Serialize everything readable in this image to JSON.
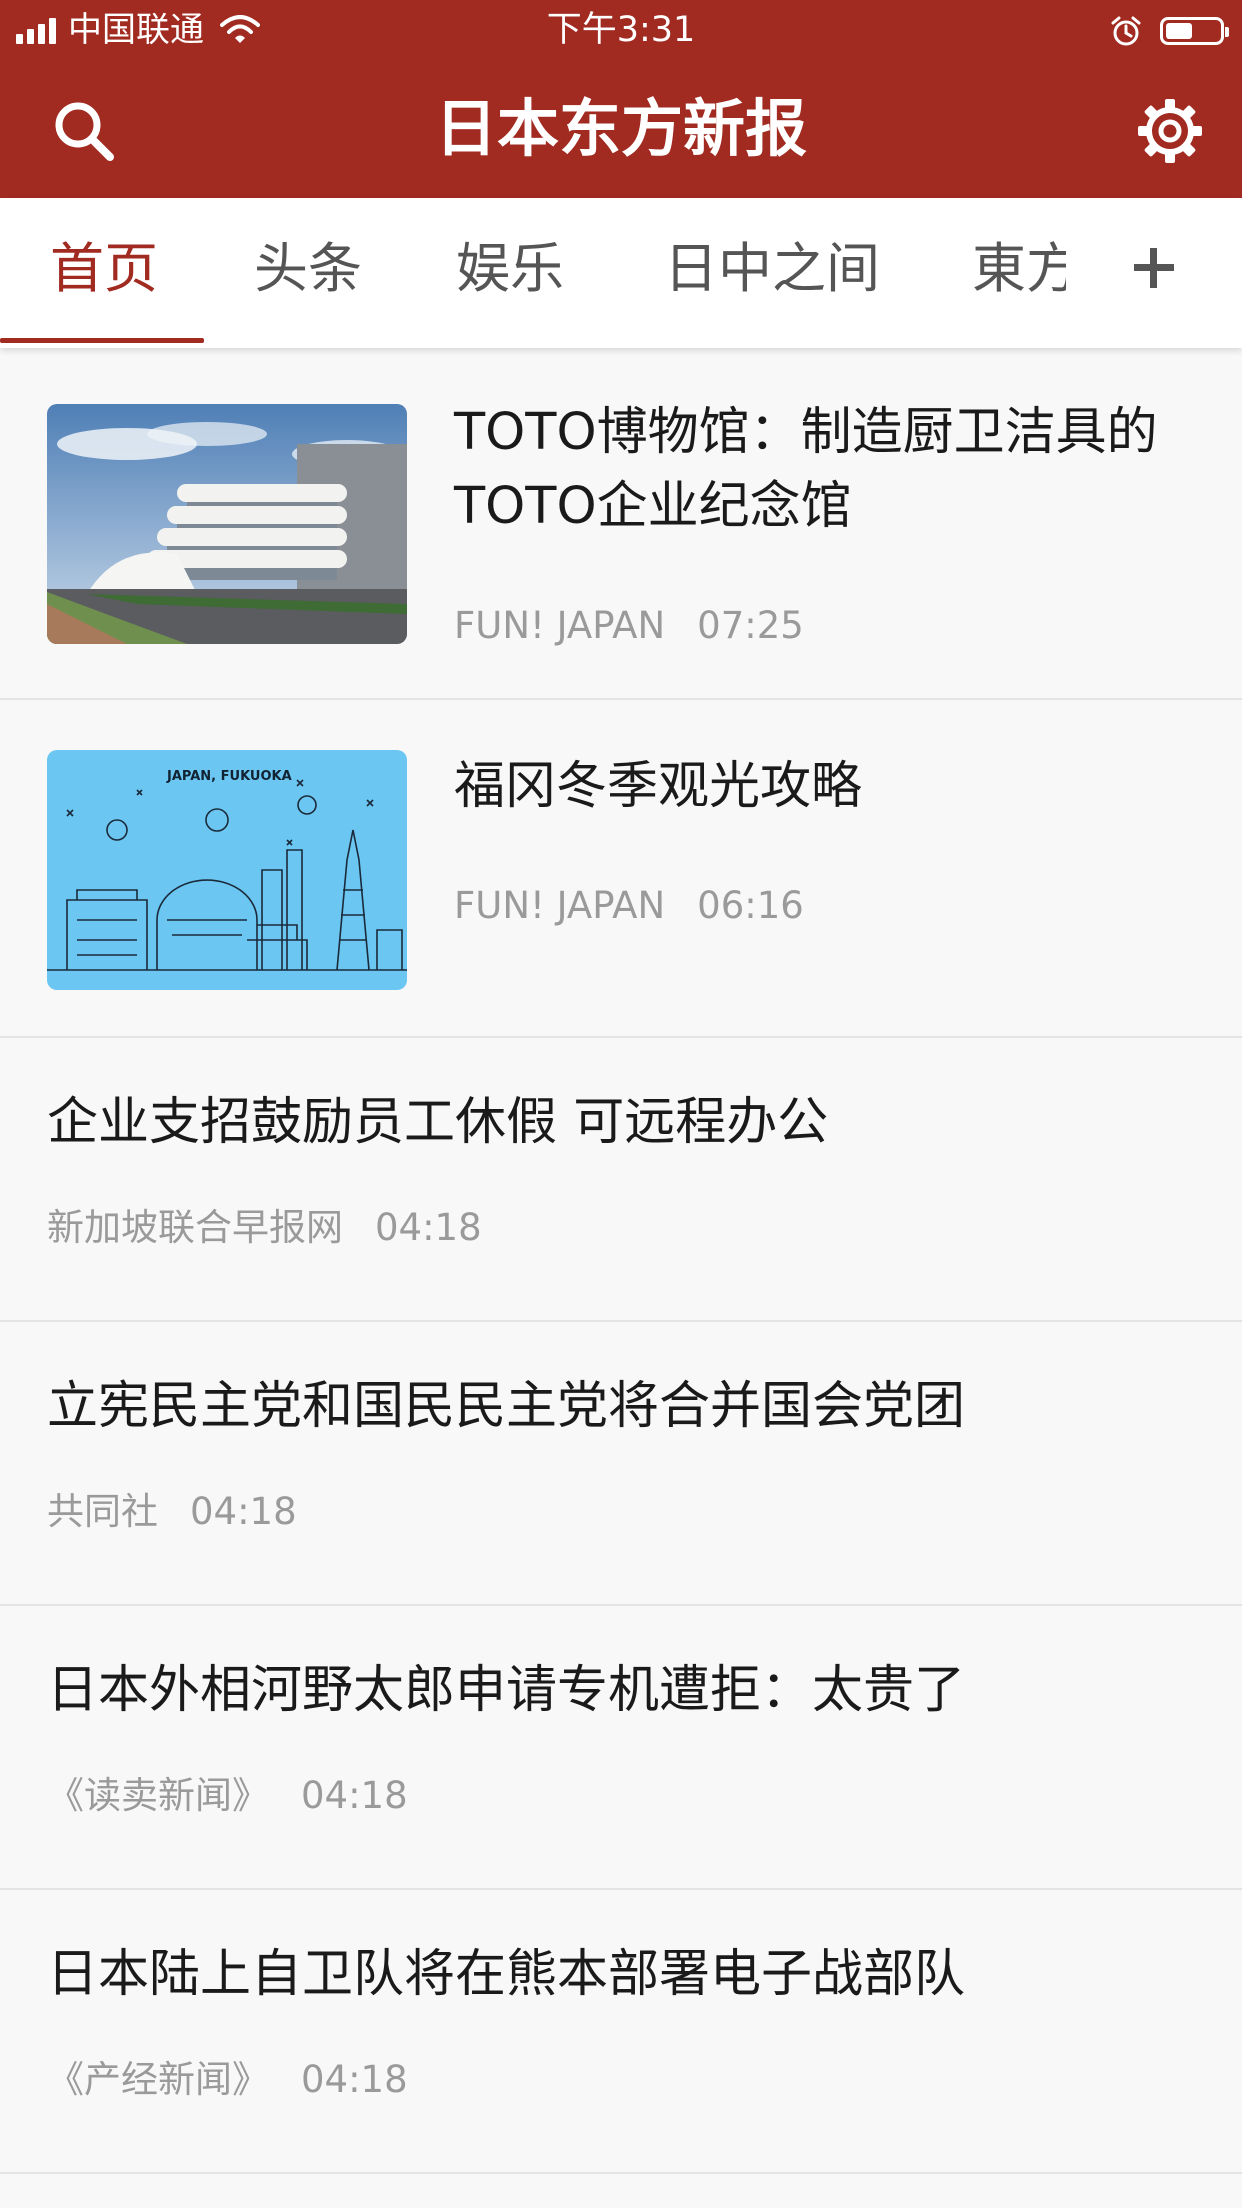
{
  "status_bar": {
    "carrier": "中国联通",
    "time": "下午3:31",
    "battery_level": 0.5
  },
  "header": {
    "title": "日本东方新报",
    "search_icon": "search-icon",
    "settings_icon": "gear-icon"
  },
  "tabs": [
    {
      "label": "首页",
      "active": true
    },
    {
      "label": "头条",
      "active": false
    },
    {
      "label": "娱乐",
      "active": false
    },
    {
      "label": "日中之间",
      "active": false
    },
    {
      "label": "東方",
      "active": false
    }
  ],
  "tab_more_icon": "plus-icon",
  "colors": {
    "brand": "#a12a21",
    "tab_active": "#a12a21",
    "meta_text": "#9a9a9a"
  },
  "news": [
    {
      "title": "TOTO博物馆：制造厨卫洁具的TOTO企业纪念馆",
      "source": "FUN! JAPAN",
      "time": "07:25",
      "thumbnail": "photo-toto-museum"
    },
    {
      "title": "福冈冬季观光攻略",
      "source": "FUN! JAPAN",
      "time": "06:16",
      "thumbnail": "illustration-fukuoka",
      "thumbnail_text": "JAPAN, FUKUOKA"
    },
    {
      "title": "企业支招鼓励员工休假 可远程办公",
      "source": "新加坡联合早报网",
      "time": "04:18"
    },
    {
      "title": "立宪民主党和国民民主党将合并国会党团",
      "source": "共同社",
      "time": "04:18"
    },
    {
      "title": "日本外相河野太郎申请专机遭拒：太贵了",
      "source": "《读卖新闻》",
      "time": "04:18"
    },
    {
      "title": "日本陆上自卫队将在熊本部署电子战部队",
      "source": "《产经新闻》",
      "time": "04:18"
    }
  ]
}
